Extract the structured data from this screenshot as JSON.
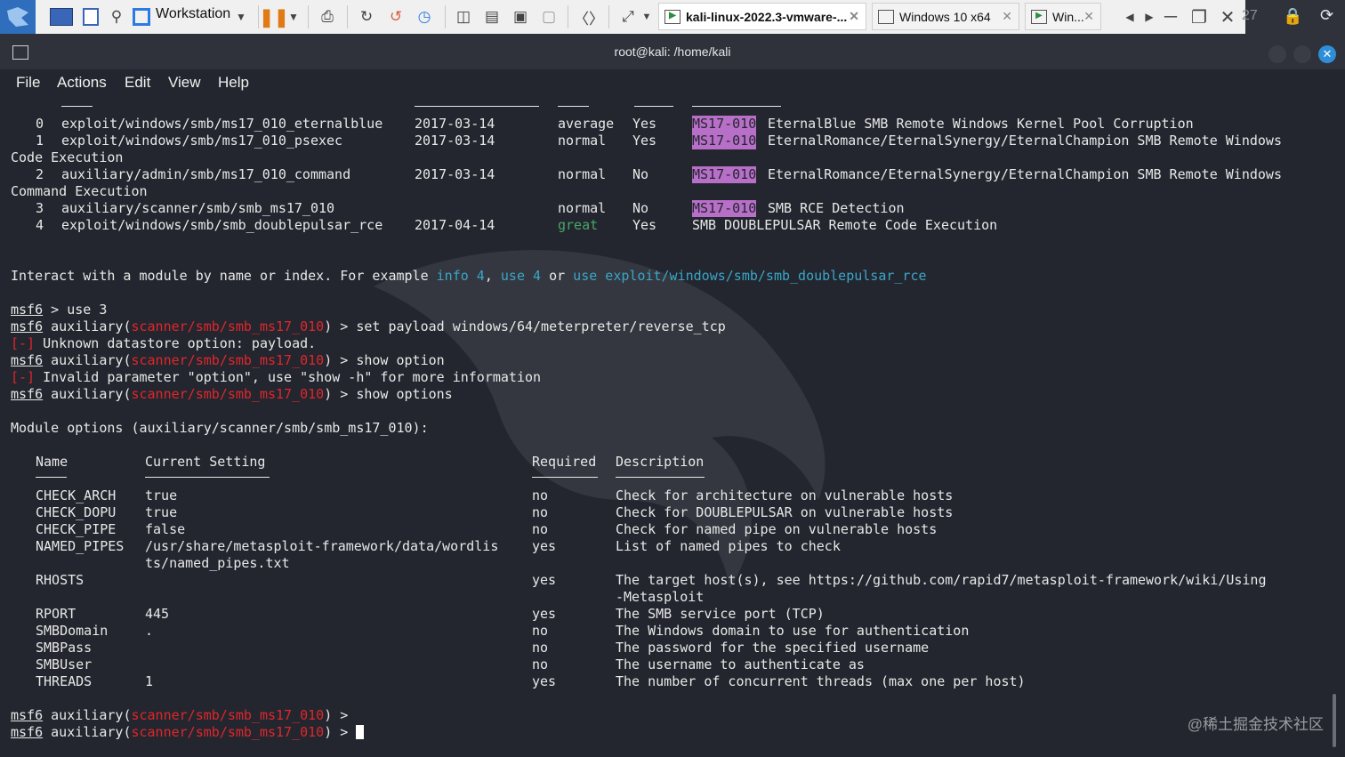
{
  "vmware": {
    "app_name": "Workstation",
    "tabs": [
      {
        "label": "kali-linux-2022.3-vmware-..."
      },
      {
        "label": "Windows 10 x64"
      },
      {
        "label": "Win..."
      }
    ],
    "clock_fragment": "27"
  },
  "window": {
    "title": "root@kali: /home/kali",
    "menu": [
      "File",
      "Actions",
      "Edit",
      "View",
      "Help"
    ]
  },
  "search_results": {
    "rows": [
      {
        "index": "0",
        "module": "exploit/windows/smb/ms17_010_eternalblue",
        "date": "2017-03-14",
        "rank": "average",
        "check": "Yes",
        "tag": "MS17-010",
        "description": "EternalBlue SMB Remote Windows Kernel Pool Corruption",
        "wrap": ""
      },
      {
        "index": "1",
        "module": "exploit/windows/smb/ms17_010_psexec",
        "date": "2017-03-14",
        "rank": "normal",
        "check": "Yes",
        "tag": "MS17-010",
        "description": "EternalRomance/EternalSynergy/EternalChampion SMB Remote Windows",
        "wrap": "Code Execution"
      },
      {
        "index": "2",
        "module": "auxiliary/admin/smb/ms17_010_command",
        "date": "2017-03-14",
        "rank": "normal",
        "check": "No",
        "tag": "MS17-010",
        "description": "EternalRomance/EternalSynergy/EternalChampion SMB Remote Windows",
        "wrap": "Command Execution"
      },
      {
        "index": "3",
        "module": "auxiliary/scanner/smb/smb_ms17_010",
        "date": "",
        "rank": "normal",
        "check": "No",
        "tag": "MS17-010",
        "description": "SMB RCE Detection",
        "wrap": ""
      },
      {
        "index": "4",
        "module": "exploit/windows/smb/smb_doublepulsar_rce",
        "date": "2017-04-14",
        "rank": "great",
        "check": "Yes",
        "tag": "",
        "description": "SMB DOUBLEPULSAR Remote Code Execution",
        "wrap": ""
      }
    ],
    "hint_prefix": "Interact with a module by name or index. For example ",
    "hint_info": "info 4",
    "hint_sep1": ", ",
    "hint_use": "use 4",
    "hint_or": " or ",
    "hint_use_path": "use exploit/windows/smb/smb_doublepulsar_rce"
  },
  "session": {
    "prompt": "msf6",
    "module_type": "auxiliary",
    "module_path": "scanner/smb/smb_ms17_010",
    "cmd_use": " > use 3",
    "cmd_set": " > set payload windows/64/meterpreter/reverse_tcp",
    "err_mark": "[-]",
    "err_unknown": " Unknown datastore option: payload.",
    "cmd_show_option": " > show option",
    "err_invalid": " Invalid parameter \"option\", use \"show -h\" for more information",
    "cmd_show_options": " > show options",
    "module_options_header": "Module options (auxiliary/scanner/smb/smb_ms17_010):",
    "prompt_tail": " >"
  },
  "options_table": {
    "headers": {
      "name": "Name",
      "setting": "Current Setting",
      "required": "Required",
      "description": "Description"
    },
    "rows": [
      {
        "name": "CHECK_ARCH",
        "setting": "true",
        "required": "no",
        "description": "Check for architecture on vulnerable hosts",
        "setting2": "",
        "description2": ""
      },
      {
        "name": "CHECK_DOPU",
        "setting": "true",
        "required": "no",
        "description": "Check for DOUBLEPULSAR on vulnerable hosts",
        "setting2": "",
        "description2": ""
      },
      {
        "name": "CHECK_PIPE",
        "setting": "false",
        "required": "no",
        "description": "Check for named pipe on vulnerable hosts",
        "setting2": "",
        "description2": ""
      },
      {
        "name": "NAMED_PIPES",
        "setting": "/usr/share/metasploit-framework/data/wordlis",
        "required": "yes",
        "description": "List of named pipes to check",
        "setting2": "ts/named_pipes.txt",
        "description2": ""
      },
      {
        "name": "RHOSTS",
        "setting": "",
        "required": "yes",
        "description": "The target host(s), see https://github.com/rapid7/metasploit-framework/wiki/Using",
        "setting2": "",
        "description2": "-Metasploit"
      },
      {
        "name": "RPORT",
        "setting": "445",
        "required": "yes",
        "description": "The SMB service port (TCP)",
        "setting2": "",
        "description2": ""
      },
      {
        "name": "SMBDomain",
        "setting": ".",
        "required": "no",
        "description": "The Windows domain to use for authentication",
        "setting2": "",
        "description2": ""
      },
      {
        "name": "SMBPass",
        "setting": "",
        "required": "no",
        "description": "The password for the specified username",
        "setting2": "",
        "description2": ""
      },
      {
        "name": "SMBUser",
        "setting": "",
        "required": "no",
        "description": "The username to authenticate as",
        "setting2": "",
        "description2": ""
      },
      {
        "name": "THREADS",
        "setting": "1",
        "required": "yes",
        "description": "The number of concurrent threads (max one per host)",
        "setting2": "",
        "description2": ""
      }
    ]
  },
  "watermark": "@稀土掘金技术社区",
  "colors": {
    "terminal_bg": "#23262e",
    "tag_bg": "#b86fc8",
    "error_red": "#e0262c",
    "link_blue": "#3aa6c8",
    "rank_great": "#48a56a"
  }
}
